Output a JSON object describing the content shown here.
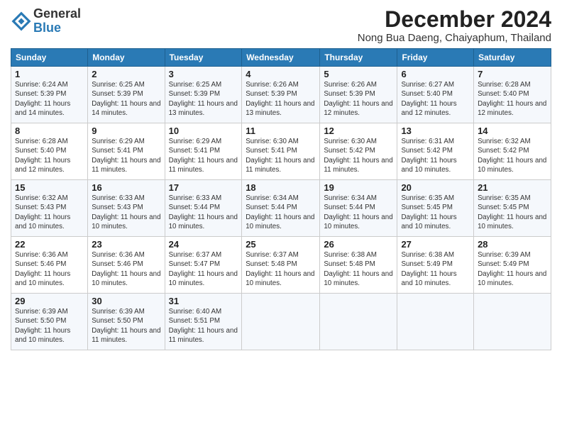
{
  "logo": {
    "general": "General",
    "blue": "Blue"
  },
  "title": "December 2024",
  "location": "Nong Bua Daeng, Chaiyaphum, Thailand",
  "days_of_week": [
    "Sunday",
    "Monday",
    "Tuesday",
    "Wednesday",
    "Thursday",
    "Friday",
    "Saturday"
  ],
  "weeks": [
    [
      {
        "day": "1",
        "sunrise": "Sunrise: 6:24 AM",
        "sunset": "Sunset: 5:39 PM",
        "daylight": "Daylight: 11 hours and 14 minutes."
      },
      {
        "day": "2",
        "sunrise": "Sunrise: 6:25 AM",
        "sunset": "Sunset: 5:39 PM",
        "daylight": "Daylight: 11 hours and 14 minutes."
      },
      {
        "day": "3",
        "sunrise": "Sunrise: 6:25 AM",
        "sunset": "Sunset: 5:39 PM",
        "daylight": "Daylight: 11 hours and 13 minutes."
      },
      {
        "day": "4",
        "sunrise": "Sunrise: 6:26 AM",
        "sunset": "Sunset: 5:39 PM",
        "daylight": "Daylight: 11 hours and 13 minutes."
      },
      {
        "day": "5",
        "sunrise": "Sunrise: 6:26 AM",
        "sunset": "Sunset: 5:39 PM",
        "daylight": "Daylight: 11 hours and 12 minutes."
      },
      {
        "day": "6",
        "sunrise": "Sunrise: 6:27 AM",
        "sunset": "Sunset: 5:40 PM",
        "daylight": "Daylight: 11 hours and 12 minutes."
      },
      {
        "day": "7",
        "sunrise": "Sunrise: 6:28 AM",
        "sunset": "Sunset: 5:40 PM",
        "daylight": "Daylight: 11 hours and 12 minutes."
      }
    ],
    [
      {
        "day": "8",
        "sunrise": "Sunrise: 6:28 AM",
        "sunset": "Sunset: 5:40 PM",
        "daylight": "Daylight: 11 hours and 12 minutes."
      },
      {
        "day": "9",
        "sunrise": "Sunrise: 6:29 AM",
        "sunset": "Sunset: 5:41 PM",
        "daylight": "Daylight: 11 hours and 11 minutes."
      },
      {
        "day": "10",
        "sunrise": "Sunrise: 6:29 AM",
        "sunset": "Sunset: 5:41 PM",
        "daylight": "Daylight: 11 hours and 11 minutes."
      },
      {
        "day": "11",
        "sunrise": "Sunrise: 6:30 AM",
        "sunset": "Sunset: 5:41 PM",
        "daylight": "Daylight: 11 hours and 11 minutes."
      },
      {
        "day": "12",
        "sunrise": "Sunrise: 6:30 AM",
        "sunset": "Sunset: 5:42 PM",
        "daylight": "Daylight: 11 hours and 11 minutes."
      },
      {
        "day": "13",
        "sunrise": "Sunrise: 6:31 AM",
        "sunset": "Sunset: 5:42 PM",
        "daylight": "Daylight: 11 hours and 10 minutes."
      },
      {
        "day": "14",
        "sunrise": "Sunrise: 6:32 AM",
        "sunset": "Sunset: 5:42 PM",
        "daylight": "Daylight: 11 hours and 10 minutes."
      }
    ],
    [
      {
        "day": "15",
        "sunrise": "Sunrise: 6:32 AM",
        "sunset": "Sunset: 5:43 PM",
        "daylight": "Daylight: 11 hours and 10 minutes."
      },
      {
        "day": "16",
        "sunrise": "Sunrise: 6:33 AM",
        "sunset": "Sunset: 5:43 PM",
        "daylight": "Daylight: 11 hours and 10 minutes."
      },
      {
        "day": "17",
        "sunrise": "Sunrise: 6:33 AM",
        "sunset": "Sunset: 5:44 PM",
        "daylight": "Daylight: 11 hours and 10 minutes."
      },
      {
        "day": "18",
        "sunrise": "Sunrise: 6:34 AM",
        "sunset": "Sunset: 5:44 PM",
        "daylight": "Daylight: 11 hours and 10 minutes."
      },
      {
        "day": "19",
        "sunrise": "Sunrise: 6:34 AM",
        "sunset": "Sunset: 5:44 PM",
        "daylight": "Daylight: 11 hours and 10 minutes."
      },
      {
        "day": "20",
        "sunrise": "Sunrise: 6:35 AM",
        "sunset": "Sunset: 5:45 PM",
        "daylight": "Daylight: 11 hours and 10 minutes."
      },
      {
        "day": "21",
        "sunrise": "Sunrise: 6:35 AM",
        "sunset": "Sunset: 5:45 PM",
        "daylight": "Daylight: 11 hours and 10 minutes."
      }
    ],
    [
      {
        "day": "22",
        "sunrise": "Sunrise: 6:36 AM",
        "sunset": "Sunset: 5:46 PM",
        "daylight": "Daylight: 11 hours and 10 minutes."
      },
      {
        "day": "23",
        "sunrise": "Sunrise: 6:36 AM",
        "sunset": "Sunset: 5:46 PM",
        "daylight": "Daylight: 11 hours and 10 minutes."
      },
      {
        "day": "24",
        "sunrise": "Sunrise: 6:37 AM",
        "sunset": "Sunset: 5:47 PM",
        "daylight": "Daylight: 11 hours and 10 minutes."
      },
      {
        "day": "25",
        "sunrise": "Sunrise: 6:37 AM",
        "sunset": "Sunset: 5:48 PM",
        "daylight": "Daylight: 11 hours and 10 minutes."
      },
      {
        "day": "26",
        "sunrise": "Sunrise: 6:38 AM",
        "sunset": "Sunset: 5:48 PM",
        "daylight": "Daylight: 11 hours and 10 minutes."
      },
      {
        "day": "27",
        "sunrise": "Sunrise: 6:38 AM",
        "sunset": "Sunset: 5:49 PM",
        "daylight": "Daylight: 11 hours and 10 minutes."
      },
      {
        "day": "28",
        "sunrise": "Sunrise: 6:39 AM",
        "sunset": "Sunset: 5:49 PM",
        "daylight": "Daylight: 11 hours and 10 minutes."
      }
    ],
    [
      {
        "day": "29",
        "sunrise": "Sunrise: 6:39 AM",
        "sunset": "Sunset: 5:50 PM",
        "daylight": "Daylight: 11 hours and 10 minutes."
      },
      {
        "day": "30",
        "sunrise": "Sunrise: 6:39 AM",
        "sunset": "Sunset: 5:50 PM",
        "daylight": "Daylight: 11 hours and 11 minutes."
      },
      {
        "day": "31",
        "sunrise": "Sunrise: 6:40 AM",
        "sunset": "Sunset: 5:51 PM",
        "daylight": "Daylight: 11 hours and 11 minutes."
      },
      null,
      null,
      null,
      null
    ]
  ]
}
